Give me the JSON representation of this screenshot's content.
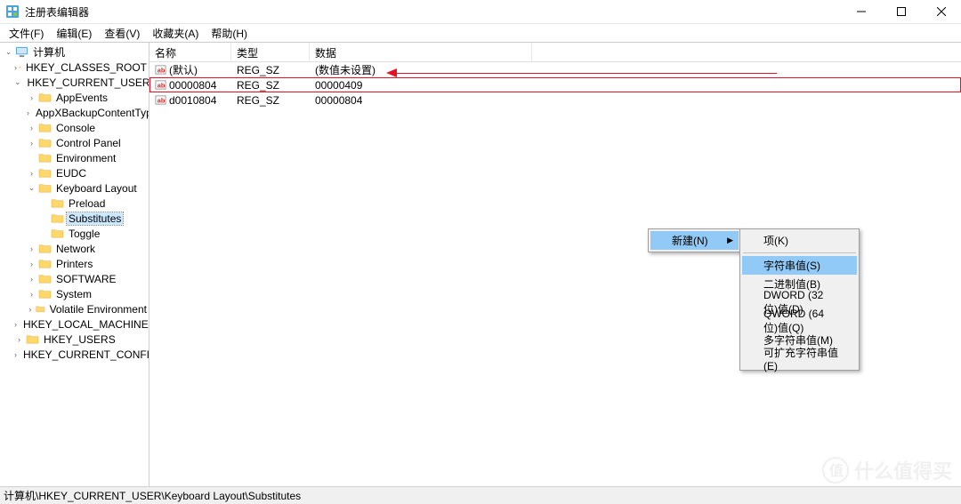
{
  "window": {
    "title": "注册表编辑器"
  },
  "menus": {
    "file": "文件(F)",
    "edit": "编辑(E)",
    "view": "查看(V)",
    "favorites": "收藏夹(A)",
    "help": "帮助(H)"
  },
  "tree": {
    "root": "计算机",
    "hkcr": "HKEY_CLASSES_ROOT",
    "hkcu": "HKEY_CURRENT_USER",
    "appevents": "AppEvents",
    "appxbackup": "AppXBackupContentType",
    "console": "Console",
    "controlpanel": "Control Panel",
    "environment": "Environment",
    "eudc": "EUDC",
    "keyboard": "Keyboard Layout",
    "preload": "Preload",
    "substitutes": "Substitutes",
    "toggle": "Toggle",
    "network": "Network",
    "printers": "Printers",
    "software": "SOFTWARE",
    "system": "System",
    "volatile": "Volatile Environment",
    "hklm": "HKEY_LOCAL_MACHINE",
    "hku": "HKEY_USERS",
    "hkcc": "HKEY_CURRENT_CONFIG"
  },
  "columns": {
    "name": "名称",
    "type": "类型",
    "data": "数据"
  },
  "rows": [
    {
      "name": "(默认)",
      "type": "REG_SZ",
      "data": "(数值未设置)"
    },
    {
      "name": "00000804",
      "type": "REG_SZ",
      "data": "00000409"
    },
    {
      "name": "d0010804",
      "type": "REG_SZ",
      "data": "00000804"
    }
  ],
  "context": {
    "new": "新建(N)",
    "submenu": {
      "key": "项(K)",
      "string": "字符串值(S)",
      "binary": "二进制值(B)",
      "dword": "DWORD (32 位)值(D)",
      "qword": "QWORD (64 位)值(Q)",
      "multistring": "多字符串值(M)",
      "expandstring": "可扩充字符串值(E)"
    }
  },
  "statusbar": "计算机\\HKEY_CURRENT_USER\\Keyboard Layout\\Substitutes",
  "watermark": "什么值得买"
}
